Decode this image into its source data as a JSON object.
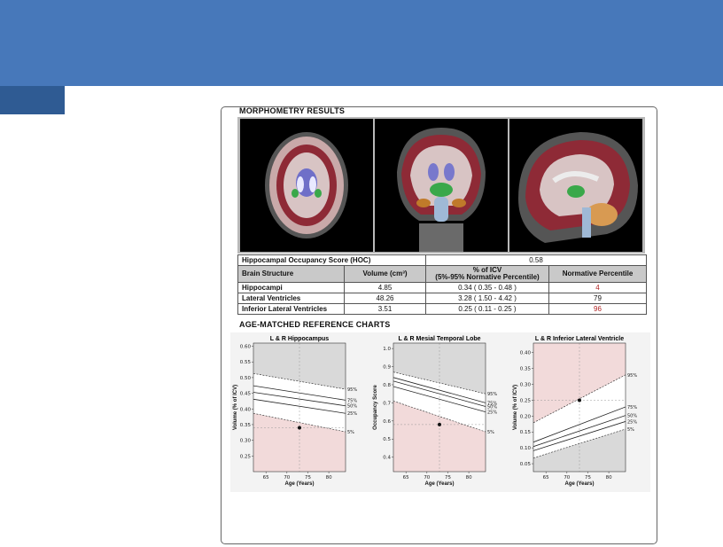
{
  "header": {
    "accent": "#4778ba",
    "tab_color": "#2f5b93"
  },
  "report": {
    "morphometry_title": "MORPHOMETRY RESULTS",
    "scans": [
      {
        "view": "axial"
      },
      {
        "view": "coronal"
      },
      {
        "view": "sagittal"
      }
    ],
    "hoc": {
      "label": "Hippocampal Occupancy Score (HOC)",
      "value": "0.58"
    },
    "table": {
      "headers": {
        "structure": "Brain Structure",
        "volume": "Volume (cm³)",
        "icv_line1": "% of ICV",
        "icv_line2": "(5%-95% Normative Percentile)",
        "percentile": "Normative Percentile"
      },
      "rows": [
        {
          "structure": "Hippocampi",
          "volume": "4.85",
          "icv": "0.34 ( 0.35 - 0.48 )",
          "percentile": "4",
          "flag": true
        },
        {
          "structure": "Lateral Ventricles",
          "volume": "48.26",
          "icv": "3.28 ( 1.50 - 4.42 )",
          "percentile": "79",
          "flag": false
        },
        {
          "structure": "Inferior Lateral Ventricles",
          "volume": "3.51",
          "icv": "0.25 ( 0.11 - 0.25 )",
          "percentile": "96",
          "flag": true
        }
      ]
    },
    "charts_title": "AGE-MATCHED REFERENCE CHARTS"
  },
  "chart_data": [
    {
      "type": "line",
      "title": "L & R Hippocampus",
      "xlabel": "Age (Years)",
      "ylabel": "Volume (% of ICV)",
      "xlim": [
        62,
        84
      ],
      "ylim": [
        0.2,
        0.61
      ],
      "xticks": [
        "65",
        "70",
        "75",
        "80"
      ],
      "yticks": [
        "0.60",
        "0.55",
        "0.50",
        "0.45",
        "0.40",
        "0.35",
        "0.30",
        "0.25"
      ],
      "shade": "below",
      "series": [
        {
          "name": "95%",
          "x": [
            62,
            84
          ],
          "values": [
            0.513,
            0.463
          ]
        },
        {
          "name": "75%",
          "x": [
            62,
            84
          ],
          "values": [
            0.474,
            0.428
          ]
        },
        {
          "name": "50%",
          "x": [
            62,
            84
          ],
          "values": [
            0.453,
            0.41
          ]
        },
        {
          "name": "25%",
          "x": [
            62,
            84
          ],
          "values": [
            0.431,
            0.386
          ]
        },
        {
          "name": "5%",
          "x": [
            62,
            84
          ],
          "values": [
            0.386,
            0.327
          ]
        }
      ],
      "point": {
        "x": 73,
        "y": 0.34
      }
    },
    {
      "type": "line",
      "title": "L & R Mesial Temporal Lobe",
      "xlabel": "Age (Years)",
      "ylabel": "Occupancy Score",
      "xlim": [
        62,
        84
      ],
      "ylim": [
        0.32,
        1.03
      ],
      "xticks": [
        "65",
        "70",
        "75",
        "80"
      ],
      "yticks": [
        "1.0",
        "0.9",
        "0.8",
        "0.7",
        "0.6",
        "0.5",
        "0.4"
      ],
      "shade": "below",
      "series": [
        {
          "name": "95%",
          "x": [
            62,
            84
          ],
          "values": [
            0.87,
            0.75
          ]
        },
        {
          "name": "75%",
          "x": [
            62,
            84
          ],
          "values": [
            0.84,
            0.7
          ]
        },
        {
          "name": "50%",
          "x": [
            62,
            84
          ],
          "values": [
            0.82,
            0.68
          ]
        },
        {
          "name": "25%",
          "x": [
            62,
            84
          ],
          "values": [
            0.79,
            0.65
          ]
        },
        {
          "name": "5%",
          "x": [
            62,
            84
          ],
          "values": [
            0.71,
            0.54
          ]
        }
      ],
      "point": {
        "x": 73,
        "y": 0.58
      }
    },
    {
      "type": "line",
      "title": "L & R Inferior Lateral Ventricle",
      "xlabel": "Age (Years)",
      "ylabel": "Volume (% of ICV)",
      "xlim": [
        62,
        84
      ],
      "ylim": [
        0.025,
        0.43
      ],
      "xticks": [
        "65",
        "70",
        "75",
        "80"
      ],
      "yticks": [
        "0.40",
        "0.35",
        "0.30",
        "0.25",
        "0.20",
        "0.15",
        "0.10",
        "0.05"
      ],
      "shade": "above",
      "series": [
        {
          "name": "95%",
          "x": [
            62,
            84
          ],
          "values": [
            0.179,
            0.33
          ]
        },
        {
          "name": "75%",
          "x": [
            62,
            84
          ],
          "values": [
            0.118,
            0.229
          ]
        },
        {
          "name": "50%",
          "x": [
            62,
            84
          ],
          "values": [
            0.104,
            0.202
          ]
        },
        {
          "name": "25%",
          "x": [
            62,
            84
          ],
          "values": [
            0.091,
            0.183
          ]
        },
        {
          "name": "5%",
          "x": [
            62,
            84
          ],
          "values": [
            0.068,
            0.159
          ]
        }
      ],
      "point": {
        "x": 73,
        "y": 0.25
      }
    }
  ]
}
